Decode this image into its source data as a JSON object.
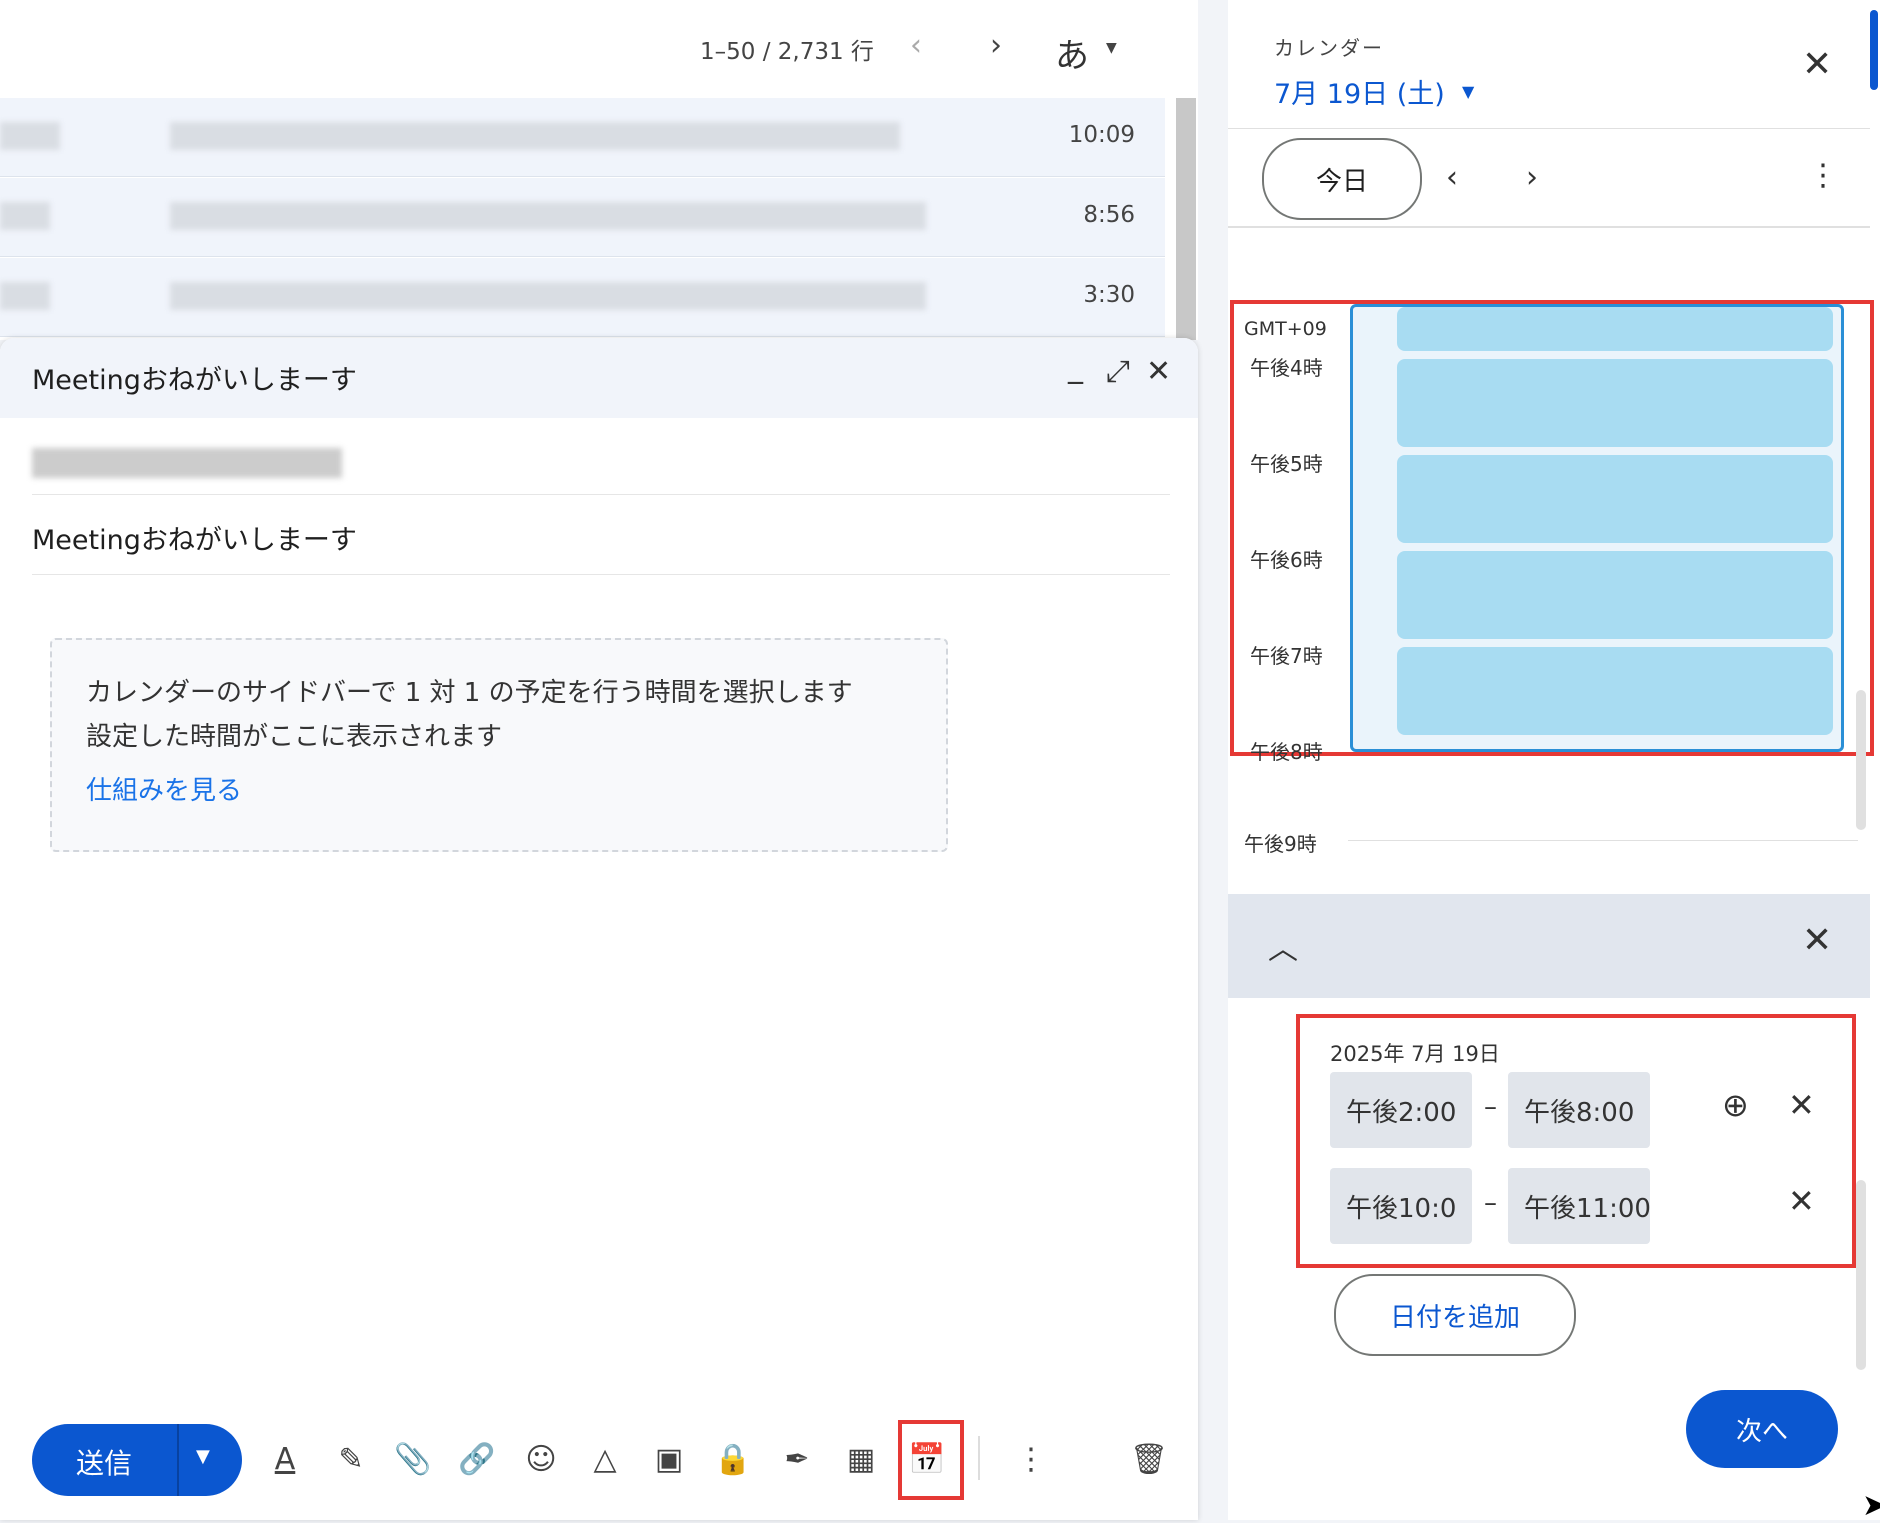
{
  "inbox": {
    "pager": "1–50 / 2,731 行",
    "input_lang": "あ",
    "rows": [
      {
        "time": "10:09"
      },
      {
        "time": "8:56"
      },
      {
        "time": "3:30"
      }
    ]
  },
  "compose": {
    "title": "Meetingおねがいしまーす",
    "subject": "Meetingおねがいしまーす",
    "hint_line1": "カレンダーのサイドバーで 1 対 1 の予定を行う時間を選択します",
    "hint_line2": "設定した時間がここに表示されます",
    "hint_link": "仕組みを見る",
    "send_label": "送信"
  },
  "calendar": {
    "label": "カレンダー",
    "date": "7月 19日 (土)",
    "today_label": "今日",
    "timezone": "GMT+09",
    "hours": [
      "午後4時",
      "午後5時",
      "午後6時",
      "午後7時",
      "午後8時",
      "午後9時"
    ],
    "slot_count": 5,
    "selection": {
      "date": "2025年 7月 19日",
      "ranges": [
        {
          "start": "午後2:00",
          "end": "午後8:00"
        },
        {
          "start": "午後10:0",
          "end": "午後11:00"
        }
      ],
      "add_date_label": "日付を追加"
    },
    "next_label": "次へ"
  },
  "colors": {
    "accent": "#0b57d0",
    "highlight_border": "#e53935",
    "slot_fill": "#a8dcf2"
  }
}
